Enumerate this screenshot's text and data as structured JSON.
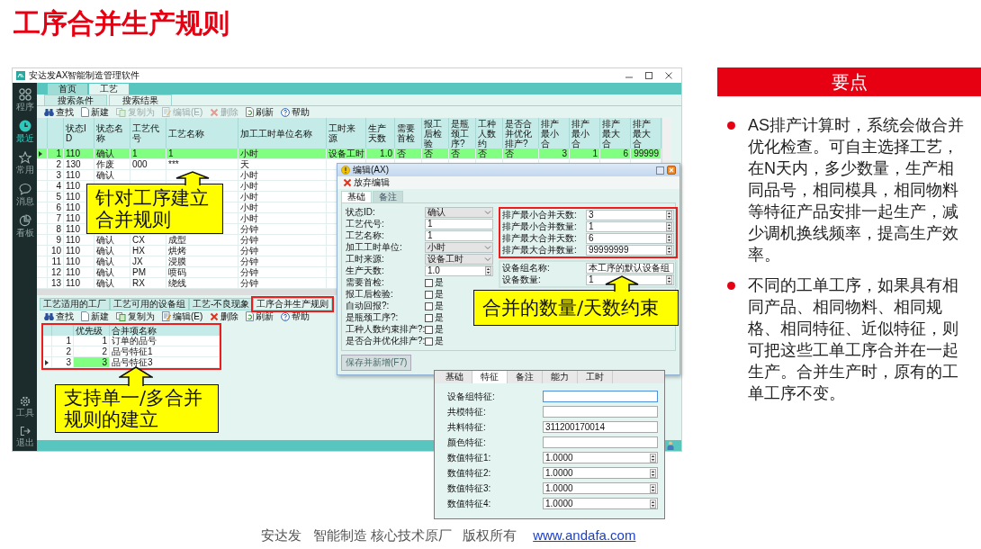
{
  "title": "工序合并生产规则",
  "app": {
    "window_title": "安达发AX智能制造管理软件",
    "sidebar": [
      {
        "label": "程序",
        "kind": "grid",
        "selected": false
      },
      {
        "label": "最近",
        "kind": "clock",
        "selected": true
      },
      {
        "label": "常用",
        "kind": "star",
        "selected": false
      },
      {
        "label": "消息",
        "kind": "chat",
        "selected": false
      },
      {
        "label": "看板",
        "kind": "pie",
        "selected": false
      }
    ],
    "sidebar_bottom": [
      {
        "label": "工具",
        "kind": "gear"
      },
      {
        "label": "退出",
        "kind": "exit"
      }
    ],
    "tabs": [
      {
        "label": "首页",
        "selected": false
      },
      {
        "label": "工艺",
        "selected": true
      }
    ],
    "subtabs": [
      {
        "label": "搜索条件",
        "selected": false
      },
      {
        "label": "搜索结果",
        "selected": true
      }
    ],
    "toolbar": [
      {
        "label": "查找",
        "kind": "find",
        "disabled": false
      },
      {
        "label": "新建",
        "kind": "new",
        "disabled": false
      },
      {
        "label": "复制为",
        "kind": "copy",
        "disabled": true
      },
      {
        "label": "编辑(E)",
        "kind": "edit",
        "disabled": true
      },
      {
        "label": "删除",
        "kind": "delete",
        "disabled": true
      },
      {
        "label": "刷新",
        "kind": "refresh",
        "disabled": false
      },
      {
        "label": "帮助",
        "kind": "help",
        "disabled": false
      }
    ],
    "grid": {
      "columns": [
        "",
        "状态ID",
        "状态名称",
        "工艺代号",
        "工艺名称",
        "加工工时单位名称",
        "工时来源",
        "生产天数",
        "需要首检",
        "报工后检验",
        "是瓶颈工序?",
        "工种人数约",
        "是否合并优化排产?",
        "排产最小合",
        "排产最小合",
        "排产最大合",
        "排产最大合"
      ],
      "rows": [
        {
          "selected": true,
          "cells": [
            "1",
            "110",
            "确认",
            "1",
            "1",
            "小时",
            "设备工时",
            "1.0",
            "否",
            "否",
            "否",
            "否",
            "否",
            "3",
            "1",
            "6",
            "99999"
          ]
        },
        {
          "selected": false,
          "cells": [
            "2",
            "130",
            "作废",
            "000",
            "***",
            "天"
          ]
        },
        {
          "selected": false,
          "cells": [
            "3",
            "110",
            "确认",
            null,
            null,
            "小时"
          ]
        },
        {
          "selected": false,
          "cells": [
            "4",
            "110",
            null,
            null,
            null,
            "小时"
          ]
        },
        {
          "selected": false,
          "cells": [
            "5",
            "110",
            null,
            null,
            null,
            "小时"
          ]
        },
        {
          "selected": false,
          "cells": [
            "6",
            "110",
            null,
            null,
            null,
            "小时"
          ]
        },
        {
          "selected": false,
          "cells": [
            "7",
            "110",
            null,
            null,
            null,
            "小时"
          ]
        },
        {
          "selected": false,
          "cells": [
            "8",
            "110",
            null,
            null,
            null,
            "分钟"
          ]
        },
        {
          "selected": false,
          "cells": [
            "9",
            "110",
            "确认",
            "CX",
            "成型",
            "分钟"
          ]
        },
        {
          "selected": false,
          "cells": [
            "10",
            "110",
            "确认",
            "HX",
            "烘烤",
            "分钟"
          ]
        },
        {
          "selected": false,
          "cells": [
            "11",
            "110",
            "确认",
            "JX",
            "浸膜",
            "分钟"
          ]
        },
        {
          "selected": false,
          "cells": [
            "12",
            "110",
            "确认",
            "PM",
            "喷码",
            "分钟"
          ]
        },
        {
          "selected": false,
          "cells": [
            "13",
            "110",
            "确认",
            "RX",
            "绕线",
            "分钟"
          ]
        }
      ]
    },
    "detail_tabs": [
      {
        "label": "工艺适用的工厂",
        "selected": false,
        "annotated": false
      },
      {
        "label": "工艺可用的设备组",
        "selected": false,
        "annotated": false
      },
      {
        "label": "工艺-不良现象",
        "selected": false,
        "annotated": false
      },
      {
        "label": "工序合并生产规则",
        "selected": true,
        "annotated": true
      }
    ],
    "detail_toolbar": [
      {
        "label": "查找",
        "kind": "find",
        "disabled": false
      },
      {
        "label": "新建",
        "kind": "new",
        "disabled": false
      },
      {
        "label": "复制为",
        "kind": "copy",
        "disabled": false
      },
      {
        "label": "编辑(E)",
        "kind": "edit",
        "disabled": false
      },
      {
        "label": "删除",
        "kind": "delete",
        "disabled": false
      },
      {
        "label": "刷新",
        "kind": "refresh",
        "disabled": false
      },
      {
        "label": "帮助",
        "kind": "help",
        "disabled": false
      }
    ],
    "rule_grid": {
      "annotated": true,
      "columns": [
        "",
        "优先级",
        "合并项名称"
      ],
      "rows": [
        {
          "selected": false,
          "cells": [
            "1",
            "1",
            "订单的品号"
          ]
        },
        {
          "selected": false,
          "cells": [
            "2",
            "2",
            "品号特征1"
          ]
        },
        {
          "selected": true,
          "cells": [
            "3",
            "3",
            "品号特征3"
          ]
        }
      ]
    }
  },
  "edit_dialog": {
    "title": "编辑(AX)",
    "discard": "放弃编辑",
    "tabs": [
      {
        "label": "基础",
        "selected": true
      },
      {
        "label": "备注",
        "selected": false
      }
    ],
    "left_fields": [
      {
        "label": "状态ID:",
        "kind": "select",
        "value": "确认"
      },
      {
        "label": "工艺代号:",
        "kind": "text",
        "value": "1"
      },
      {
        "label": "工艺名称:",
        "kind": "text",
        "value": "1"
      },
      {
        "label": "加工工时单位:",
        "kind": "select",
        "value": "小时"
      },
      {
        "label": "工时来源:",
        "kind": "select",
        "value": "设备工时"
      },
      {
        "label": "生产天数:",
        "kind": "spin",
        "value": "1.0"
      },
      {
        "label": "需要首检:",
        "kind": "check",
        "option": "是",
        "checked": false
      },
      {
        "label": "报工后检验:",
        "kind": "check",
        "option": "是",
        "checked": false
      },
      {
        "label": "自动回报?:",
        "kind": "check",
        "option": "是",
        "checked": false
      },
      {
        "label": "是瓶颈工序?:",
        "kind": "check",
        "option": "是",
        "checked": false
      },
      {
        "label": "工种人数约束排产?:",
        "kind": "check",
        "option": "是",
        "checked": false
      },
      {
        "label": "是否合并优化排产?:",
        "kind": "check",
        "option": "是",
        "checked": false
      }
    ],
    "right_groups": [
      {
        "annotated": true,
        "fields": [
          {
            "label": "排产最小合并天数:",
            "kind": "spin",
            "value": "3"
          },
          {
            "label": "排产最小合并数量:",
            "kind": "spin",
            "value": "1"
          },
          {
            "label": "排产最大合并天数:",
            "kind": "spin",
            "value": "6"
          },
          {
            "label": "排产最大合并数量:",
            "kind": "spin",
            "value": "99999999"
          }
        ]
      },
      {
        "annotated": false,
        "fields": [
          {
            "label": "设备组名称:",
            "kind": "text",
            "value": "本工序的默认设备组"
          },
          {
            "label": "设备数量:",
            "kind": "spin",
            "value": "1"
          }
        ]
      }
    ],
    "save_button": "保存并新增(F7)"
  },
  "feature_panel": {
    "tabs": [
      {
        "label": "基础",
        "selected": false
      },
      {
        "label": "特征",
        "selected": true
      },
      {
        "label": "备注",
        "selected": false
      },
      {
        "label": "能力",
        "selected": false
      },
      {
        "label": "工时",
        "selected": false
      }
    ],
    "fields": [
      {
        "label": "设备组特征:",
        "kind": "text",
        "focused": true
      },
      {
        "label": "共模特征:",
        "kind": "text",
        "focused": false
      },
      {
        "label": "共料特征:",
        "kind": "text",
        "value": "311200170014",
        "focused": false
      },
      {
        "label": "颜色特征:",
        "kind": "text",
        "focused": false
      },
      {
        "label": "数值特征1:",
        "kind": "spin",
        "value": "1.0000",
        "focused": false
      },
      {
        "label": "数值特征2:",
        "kind": "spin",
        "value": "1.0000",
        "focused": false
      },
      {
        "label": "数值特征3:",
        "kind": "spin",
        "value": "1.0000",
        "focused": false
      },
      {
        "label": "数值特征4:",
        "kind": "spin",
        "value": "1.0000",
        "focused": false
      }
    ]
  },
  "callouts": [
    {
      "text": "针对工序建立合并规则"
    },
    {
      "text": "合并的数量/天数约束"
    },
    {
      "text": "支持单一/多合并规则的建立"
    }
  ],
  "key_points": {
    "heading": "要点",
    "bullets": [
      "AS排产计算时，系统会做合并优化检查。可自主选择工艺，在N天内，多少数量，生产相同品号，相同模具，相同物料等特征产品安排一起生产，减少调机换线频率，提高生产效率。",
      "不同的工单工序，如果具有相同产品、相同物料、相同规格、相同特征、近似特征，则可把这些工单工序合并在一起生产。合并生产时，原有的工单工序不变。"
    ]
  },
  "footer": {
    "text": "安达发   智能制造 核心技术原厂   版权所有",
    "link": "www.andafa.com"
  }
}
